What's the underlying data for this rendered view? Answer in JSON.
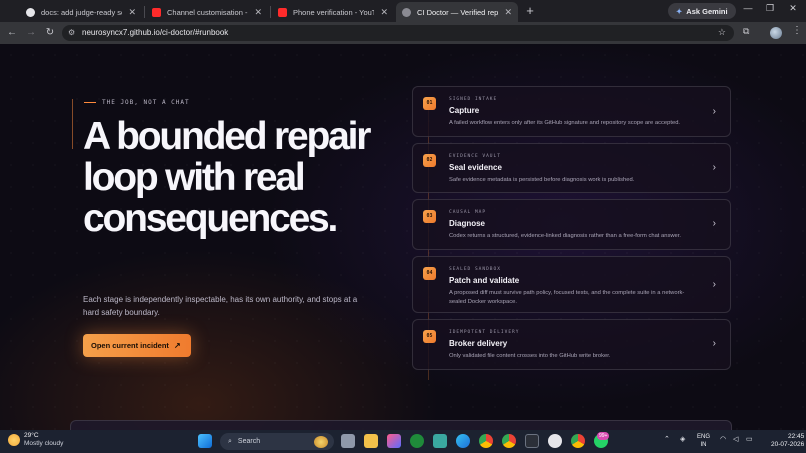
{
  "browser": {
    "tabs": [
      {
        "title": "docs: add judge-ready setup ar",
        "icon": "github-icon",
        "active": false
      },
      {
        "title": "Channel customisation - YouTu",
        "icon": "youtube-icon",
        "active": false
      },
      {
        "title": "Phone verification - YouTube",
        "icon": "youtube-icon",
        "active": false
      },
      {
        "title": "CI Doctor — Verified repair",
        "icon": "globe-icon",
        "active": true
      }
    ],
    "new_tab": "+",
    "gemini_label": "Ask Gemini",
    "url": "neurosyncx7.github.io/ci-doctor/#runbook"
  },
  "page": {
    "eyebrow": "THE JOB, NOT A CHAT",
    "headline": "A bounded repair loop with real consequences.",
    "lede": "Each stage is independently inspectable, has its own authority, and stops at a hard safety boundary.",
    "cta": "Open current incident",
    "cta_icon": "↗",
    "stages": [
      {
        "num": "01",
        "tag": "SIGNED INTAKE",
        "name": "Capture",
        "desc": "A failed workflow enters only after its GitHub signature and repository scope are accepted."
      },
      {
        "num": "02",
        "tag": "EVIDENCE VAULT",
        "name": "Seal evidence",
        "desc": "Safe evidence metadata is persisted before diagnosis work is published."
      },
      {
        "num": "03",
        "tag": "CAUSAL MAP",
        "name": "Diagnose",
        "desc": "Codex returns a structured, evidence-linked diagnosis rather than a free-form chat answer."
      },
      {
        "num": "04",
        "tag": "SEALED SANDBOX",
        "name": "Patch and validate",
        "desc": "A proposed diff must survive path policy, focused tests, and the complete suite in a network-sealed Docker workspace."
      },
      {
        "num": "05",
        "tag": "IDEMPOTENT DELIVERY",
        "name": "Broker delivery",
        "desc": "Only validated file content crosses into the GitHub write broker."
      }
    ]
  },
  "taskbar": {
    "temperature": "29°C",
    "condition": "Mostly cloudy",
    "search_label": "Search",
    "lang_top": "ENG",
    "lang_bottom": "IN",
    "time": "22:45",
    "date": "20-07-2026",
    "notification_badge": "99+"
  }
}
